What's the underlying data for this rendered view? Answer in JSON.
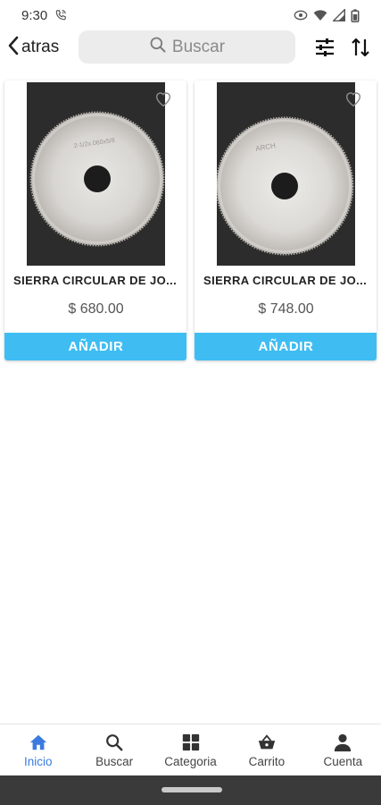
{
  "status_bar": {
    "time": "9:30",
    "icons": [
      "phone-call-icon",
      "eye-icon",
      "wifi-icon",
      "signal-icon",
      "battery-icon"
    ]
  },
  "app_bar": {
    "back_label": "atras",
    "search_placeholder": "Buscar",
    "icons": [
      "chevron-left-icon",
      "search-icon",
      "filter-sliders-icon",
      "sort-icon"
    ]
  },
  "products": [
    {
      "name": "SIERRA CIRCULAR DE JO...",
      "price": "$ 680.00",
      "add_label": "AÑADIR",
      "image_text": "2-1/2x.060x5/8"
    },
    {
      "name": "SIERRA CIRCULAR DE JO...",
      "price": "$ 748.00",
      "add_label": "AÑADIR",
      "image_text": "ARCH"
    }
  ],
  "bottom_nav": {
    "active": "Inicio",
    "items": [
      {
        "label": "Inicio",
        "icon": "home-icon"
      },
      {
        "label": "Buscar",
        "icon": "search-icon"
      },
      {
        "label": "Categoria",
        "icon": "grid-icon"
      },
      {
        "label": "Carrito",
        "icon": "basket-icon"
      },
      {
        "label": "Cuenta",
        "icon": "user-icon"
      }
    ]
  },
  "colors": {
    "accent": "#3fbdf3",
    "active_nav": "#3b7be0",
    "search_bg": "#ececec",
    "system_nav": "#3a3a3a"
  }
}
